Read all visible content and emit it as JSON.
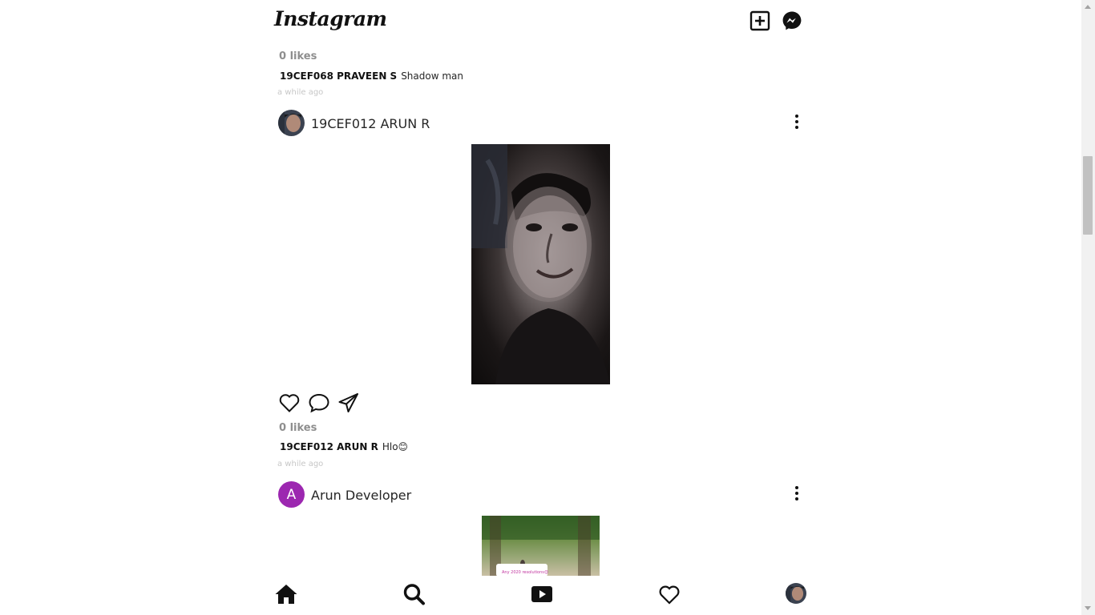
{
  "app": {
    "logo": "Instagram"
  },
  "top_bar": {
    "new_post_icon": "plus-square-icon",
    "messenger_icon": "messenger-icon"
  },
  "previous_post": {
    "likes": "0 likes",
    "username": "19CEF068 PRAVEEN S",
    "caption": "Shadow man",
    "time": "a while ago"
  },
  "posts": [
    {
      "username": "19CEF012 ARUN R",
      "avatar": "photo",
      "likes": "0 likes",
      "caption_user": "19CEF012 ARUN R",
      "caption": "Hlo😊",
      "time": "a while ago"
    },
    {
      "username": "Arun Developer",
      "avatar_letter": "A",
      "avatar_color": "#9c27b0",
      "image_text": "Any 2020 resolutions😊"
    }
  ],
  "bottom_nav": [
    {
      "icon": "home-icon"
    },
    {
      "icon": "search-icon"
    },
    {
      "icon": "video-icon"
    },
    {
      "icon": "heart-icon"
    },
    {
      "icon": "profile-avatar"
    }
  ]
}
